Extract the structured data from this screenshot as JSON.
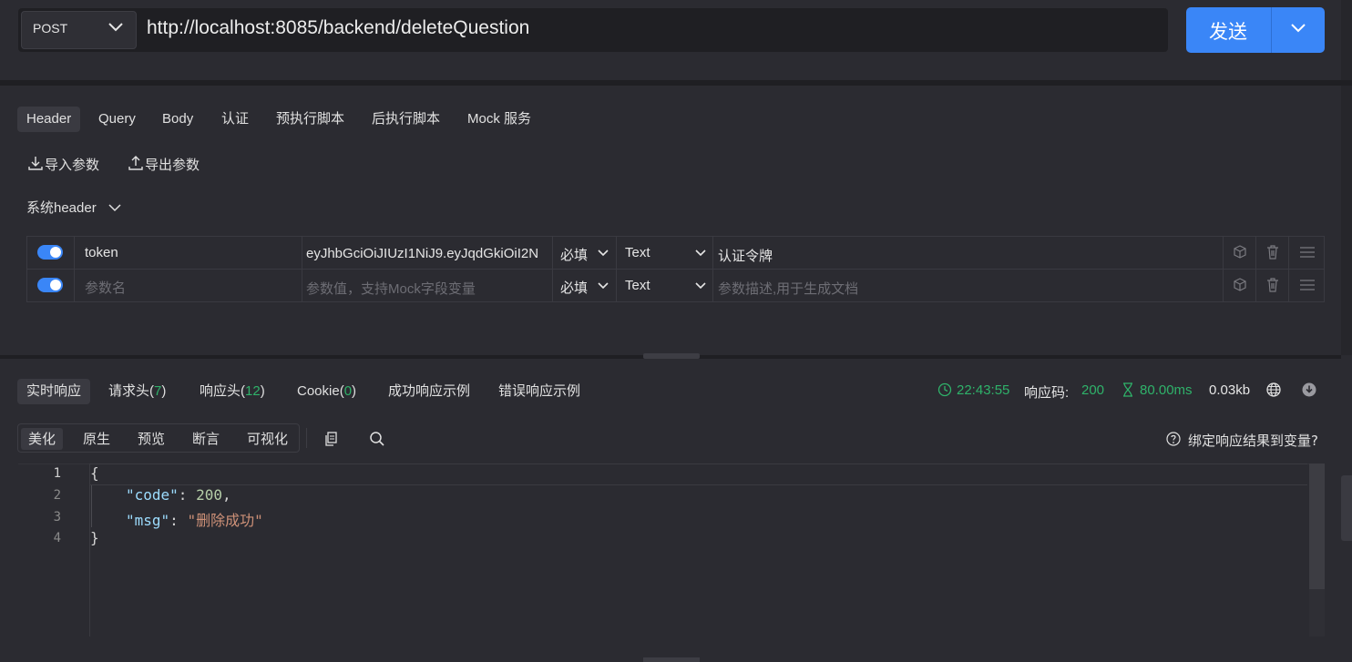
{
  "request": {
    "method": "POST",
    "url": "http://localhost:8085/backend/deleteQuestion",
    "send_label": "发送"
  },
  "tabs": [
    "Header",
    "Query",
    "Body",
    "认证",
    "预执行脚本",
    "后执行脚本",
    "Mock 服务"
  ],
  "toolbar": {
    "import_label": "导入参数",
    "export_label": "导出参数"
  },
  "system_header_label": "系统header",
  "params": [
    {
      "enabled": true,
      "name": "token",
      "value": "eyJhbGciOiJIUzI1NiJ9.eyJqdGkiOiI2N",
      "required": "必填",
      "type": "Text",
      "description": "认证令牌"
    }
  ],
  "param_placeholders": {
    "name": "参数名",
    "value": "参数值，支持Mock字段变量",
    "required": "必填",
    "type": "Text",
    "description": "参数描述,用于生成文档"
  },
  "response": {
    "tabs": {
      "realtime": "实时响应",
      "req_headers": "请求头(",
      "req_headers_count": "7",
      "res_headers": "响应头(",
      "res_headers_count": "12",
      "cookie": "Cookie(",
      "cookie_count": "0",
      "close_paren": ")",
      "success_example": "成功响应示例",
      "error_example": "错误响应示例"
    },
    "time": "22:43:55",
    "status_label": "响应码:",
    "status_code": "200",
    "duration": "80.00ms",
    "size": "0.03kb",
    "view_tabs": [
      "美化",
      "原生",
      "预览",
      "断言",
      "可视化"
    ],
    "bind_label": "绑定响应结果到变量?",
    "body_lines": [
      {
        "num": "1",
        "text": "{"
      },
      {
        "num": "2",
        "key": "\"code\"",
        "sep": ": ",
        "value": "200",
        "trail": ","
      },
      {
        "num": "3",
        "key": "\"msg\"",
        "sep": ": ",
        "value": "\"删除成功\""
      },
      {
        "num": "4",
        "text": "}"
      }
    ]
  },
  "colors": {
    "accent": "#3a86f7",
    "success": "#2fb26a",
    "background": "#2b2b31"
  }
}
